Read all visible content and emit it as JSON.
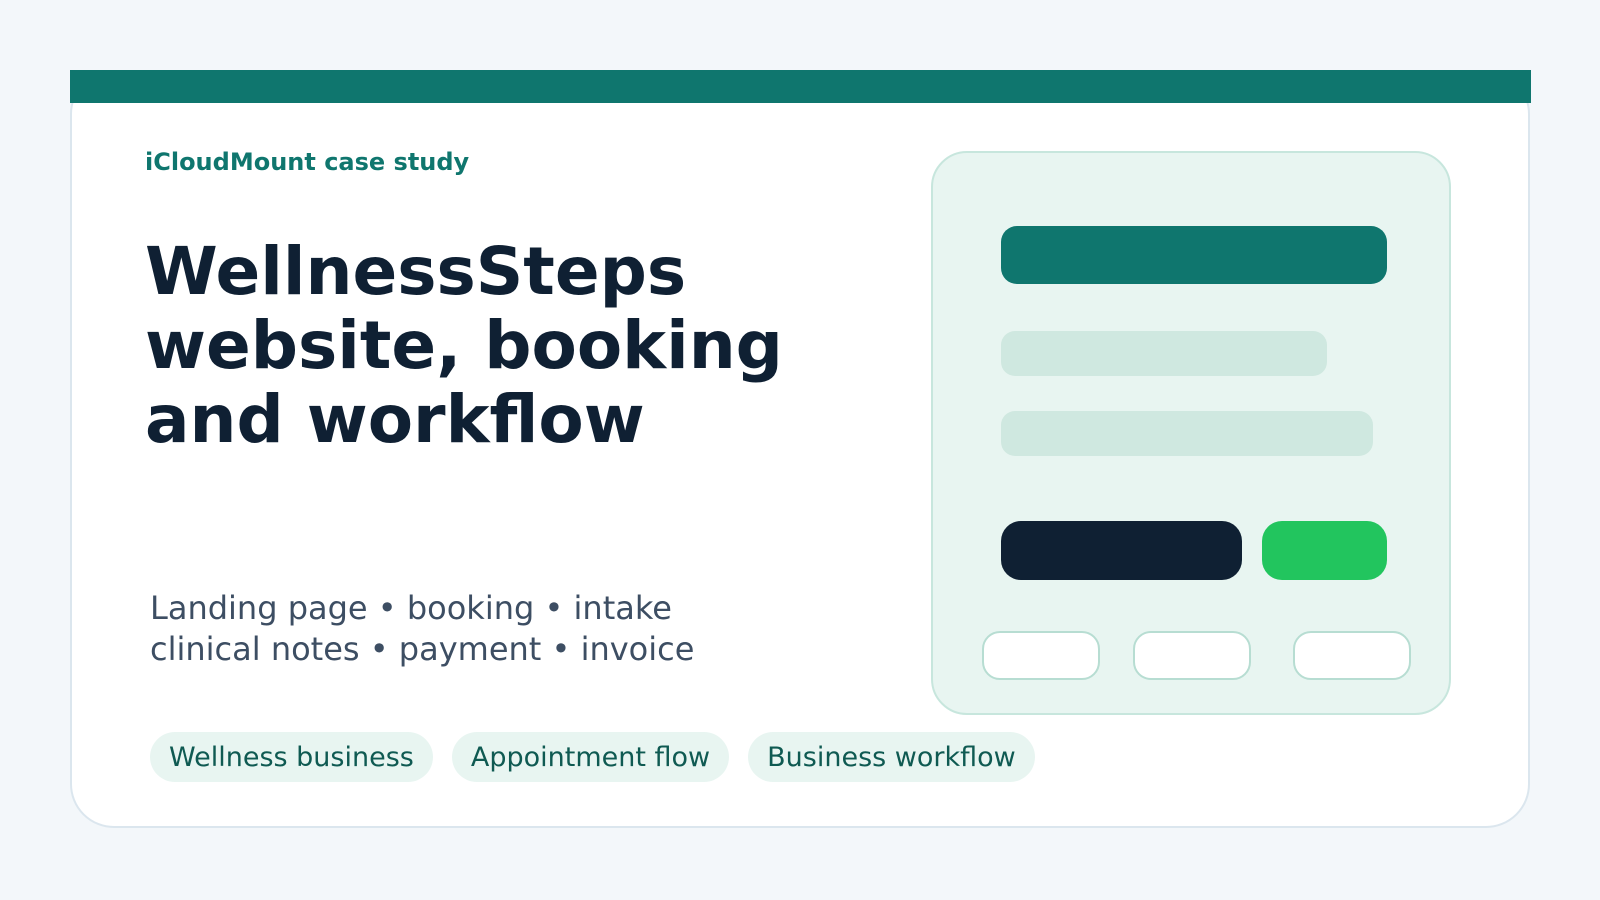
{
  "eyebrow": "iCloudMount case study",
  "title_lines": [
    "WellnessSteps",
    "website, booking",
    "and workflow"
  ],
  "subtitle_lines": [
    "Landing page • booking • intake",
    "clinical notes • payment • invoice"
  ],
  "tags": [
    "Wellness business",
    "Appointment flow",
    "Business workflow"
  ],
  "colors": {
    "accent": "#0f766e",
    "dark": "#0f2033",
    "green": "#22c55e",
    "tag_bg": "#e8f5f1",
    "page_bg": "#f3f7fa"
  }
}
